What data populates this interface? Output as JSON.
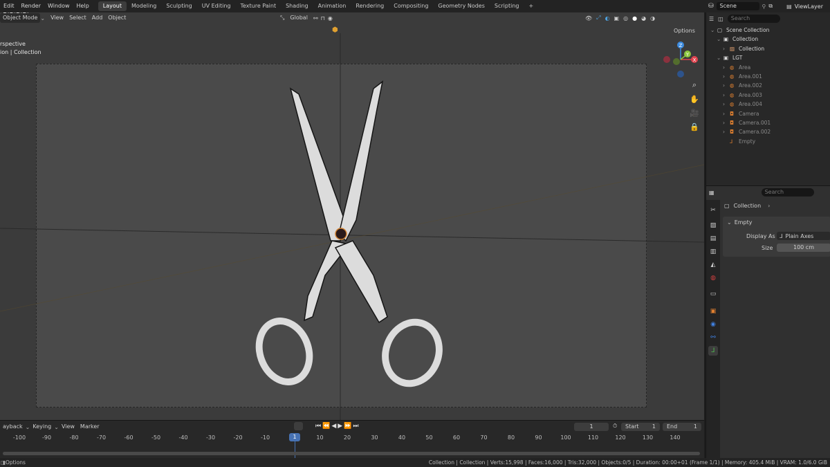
{
  "menu": [
    "Edit",
    "Render",
    "Window",
    "Help"
  ],
  "workspaces": [
    "Layout",
    "Modeling",
    "Sculpting",
    "UV Editing",
    "Texture Paint",
    "Shading",
    "Animation",
    "Rendering",
    "Compositing",
    "Geometry Nodes",
    "Scripting"
  ],
  "active_workspace": "Layout",
  "add_workspace": "+",
  "scene": {
    "name": "Scene",
    "view_layer": "ViewLayer"
  },
  "viewport": {
    "mode": "Object Mode",
    "menus": [
      "View",
      "Select",
      "Add",
      "Object"
    ],
    "orientation": "Global",
    "options_label": "Options",
    "overlay_line1": "rspective",
    "overlay_line2": "ion | Collection"
  },
  "gizmo": {
    "z": "Z",
    "x": "X",
    "y": "Y"
  },
  "outliner": {
    "search_placeholder": "Search",
    "rows": [
      {
        "label": "Scene Collection",
        "indent": 0,
        "icon": "scene-collection-icon"
      },
      {
        "label": "Collection",
        "indent": 1,
        "icon": "collection-icon"
      },
      {
        "label": "Collection",
        "indent": 2,
        "icon": "collection-instance-icon"
      },
      {
        "label": "LGT",
        "indent": 1,
        "icon": "collection-icon"
      },
      {
        "label": "Area",
        "indent": 2,
        "icon": "light-icon"
      },
      {
        "label": "Area.001",
        "indent": 2,
        "icon": "light-icon"
      },
      {
        "label": "Area.002",
        "indent": 2,
        "icon": "light-icon"
      },
      {
        "label": "Area.003",
        "indent": 2,
        "icon": "light-icon"
      },
      {
        "label": "Area.004",
        "indent": 2,
        "icon": "light-icon"
      },
      {
        "label": "Camera",
        "indent": 2,
        "icon": "camera-icon"
      },
      {
        "label": "Camera.001",
        "indent": 2,
        "icon": "camera-icon"
      },
      {
        "label": "Camera.002",
        "indent": 2,
        "icon": "camera-icon"
      },
      {
        "label": "Empty",
        "indent": 2,
        "icon": "empty-icon"
      }
    ]
  },
  "properties": {
    "search_placeholder": "Search",
    "breadcrumb": "Collection",
    "panel_title": "Empty",
    "display_as_label": "Display As",
    "display_as_value": "Plain Axes",
    "size_label": "Size",
    "size_value": "100 cm"
  },
  "timeline": {
    "menus": [
      "ayback",
      "Keying",
      "View",
      "Marker"
    ],
    "current_frame": "1",
    "start_label": "Start",
    "start_value": "1",
    "end_label": "End",
    "end_value": "1",
    "frames": [
      "-100",
      "-90",
      "-80",
      "-70",
      "-60",
      "-50",
      "-40",
      "-30",
      "-20",
      "-10",
      "1",
      "10",
      "20",
      "30",
      "40",
      "50",
      "60",
      "70",
      "80",
      "90",
      "100",
      "110",
      "120",
      "130",
      "140"
    ]
  },
  "status": {
    "left": "Options",
    "right": "Collection | Collection | Verts:15,998 | Faces:16,000 | Tris:32,000 | Objects:0/5 | Duration: 00:00+01 (Frame 1/1) | Memory: 405.4 MiB | VRAM: 1.0/6.0 GiB"
  },
  "colors": {
    "accent": "#4772b3",
    "selected_row": "#334d70",
    "axis_x": "#e0444f",
    "axis_y": "#8cc63f",
    "axis_z": "#3d8ce0"
  }
}
